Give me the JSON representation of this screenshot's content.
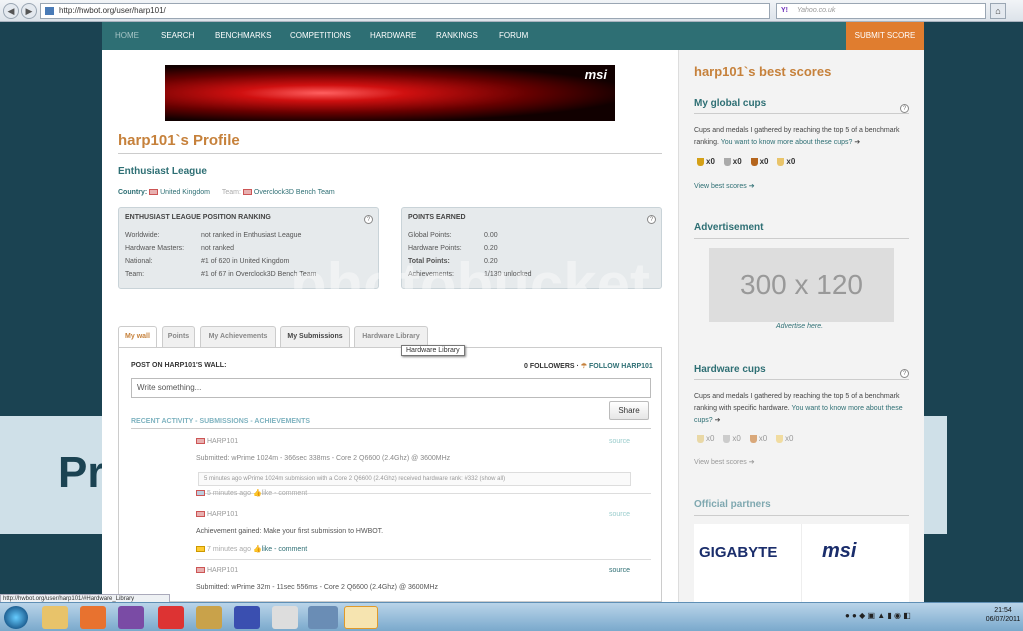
{
  "browser": {
    "url": "http://hwbot.org/user/harp101/",
    "search_placeholder": "Yahoo.co.uk",
    "yahoo": "Y!"
  },
  "nav": {
    "items": [
      "HOME",
      "SEARCH",
      "BENCHMARKS",
      "COMPETITIONS",
      "HARDWARE",
      "RANKINGS",
      "FORUM"
    ],
    "submit": "SUBMIT SCORE"
  },
  "banner": {
    "brand": "msi"
  },
  "profile": {
    "title": "harp101`s Profile",
    "league": "Enthusiast League",
    "country_label": "Country:",
    "country": "United Kingdom",
    "team_label": "Team:",
    "team": "Overclock3D Bench Team"
  },
  "rank_box": {
    "title": "ENTHUSIAST LEAGUE POSITION RANKING",
    "rows": [
      [
        "Worldwide:",
        "not ranked in Enthusiast League"
      ],
      [
        "Hardware Masters:",
        "not ranked"
      ],
      [
        "National:",
        "#1 of 620 in United Kingdom"
      ],
      [
        "Team:",
        "#1 of 67 in Overclock3D Bench Team"
      ]
    ]
  },
  "points_box": {
    "title": "POINTS EARNED",
    "rows": [
      [
        "Global Points:",
        "0.00"
      ],
      [
        "Hardware Points:",
        "0.20"
      ],
      [
        "Total Points:",
        "0.20"
      ],
      [
        "Achievements:",
        "1/130 unlocked"
      ]
    ]
  },
  "tabs": [
    "My wall",
    "Points",
    "My Achievements",
    "My Submissions",
    "Hardware Library"
  ],
  "tooltip": "Hardware Library",
  "wall": {
    "post_label": "POST ON HARP101'S WALL:",
    "followers": "0 FOLLOWERS",
    "follow": "FOLLOW HARP101",
    "input_placeholder": "Write something...",
    "share": "Share",
    "activity_header": "RECENT ACTIVITY - SUBMISSIONS - ACHIEVEMENTS"
  },
  "activity": [
    {
      "user": "HARP101",
      "text": "Submitted: wPrime 1024m - 366sec 338ms - Core 2 Q6600 (2.4Ghz) @ 3600MHz",
      "note": "5 minutes ago wPrime 1024m submission with a Core 2 Q6600 (2.4Ghz) received hardware rank: #332 (show all)",
      "time": "5 minutes ago",
      "source": "source"
    },
    {
      "user": "HARP101",
      "text": "Achievement gained: Make your first submission to HWBOT.",
      "time": "7 minutes ago",
      "source": "source"
    },
    {
      "user": "HARP101",
      "text": "Submitted: wPrime 32m - 11sec 556ms - Core 2 Q6600 (2.4Ghz) @ 3600MHz",
      "source": "source"
    }
  ],
  "like_comment": "like - comment",
  "sidebar": {
    "best_title": "harp101`s best scores",
    "global_cups": "My global cups",
    "global_text": "Cups and medals I gathered by reaching the top 5 of a benchmark ranking.",
    "global_link": "You want to know more about these cups?",
    "cup_counts": [
      "x0",
      "x0",
      "x0",
      "x0"
    ],
    "view_best": "View best scores",
    "ad_title": "Advertisement",
    "ad_size": "300 x 120",
    "ad_link": "Advertise here.",
    "hw_title": "Hardware cups",
    "hw_text": "Cups and medals I gathered by reaching the top 5 of a benchmark ranking with specific hardware.",
    "hw_link": "You want to know more about these cups?",
    "partners": "Official partners",
    "partner1": "GIGABYTE",
    "partner2": "msi"
  },
  "status_url": "http://hwbot.org/user/harp101/#Hardware_Library",
  "clock": {
    "time": "21:54",
    "date": "06/07/2011"
  },
  "watermark": "photobucket",
  "background_text": "Pr"
}
